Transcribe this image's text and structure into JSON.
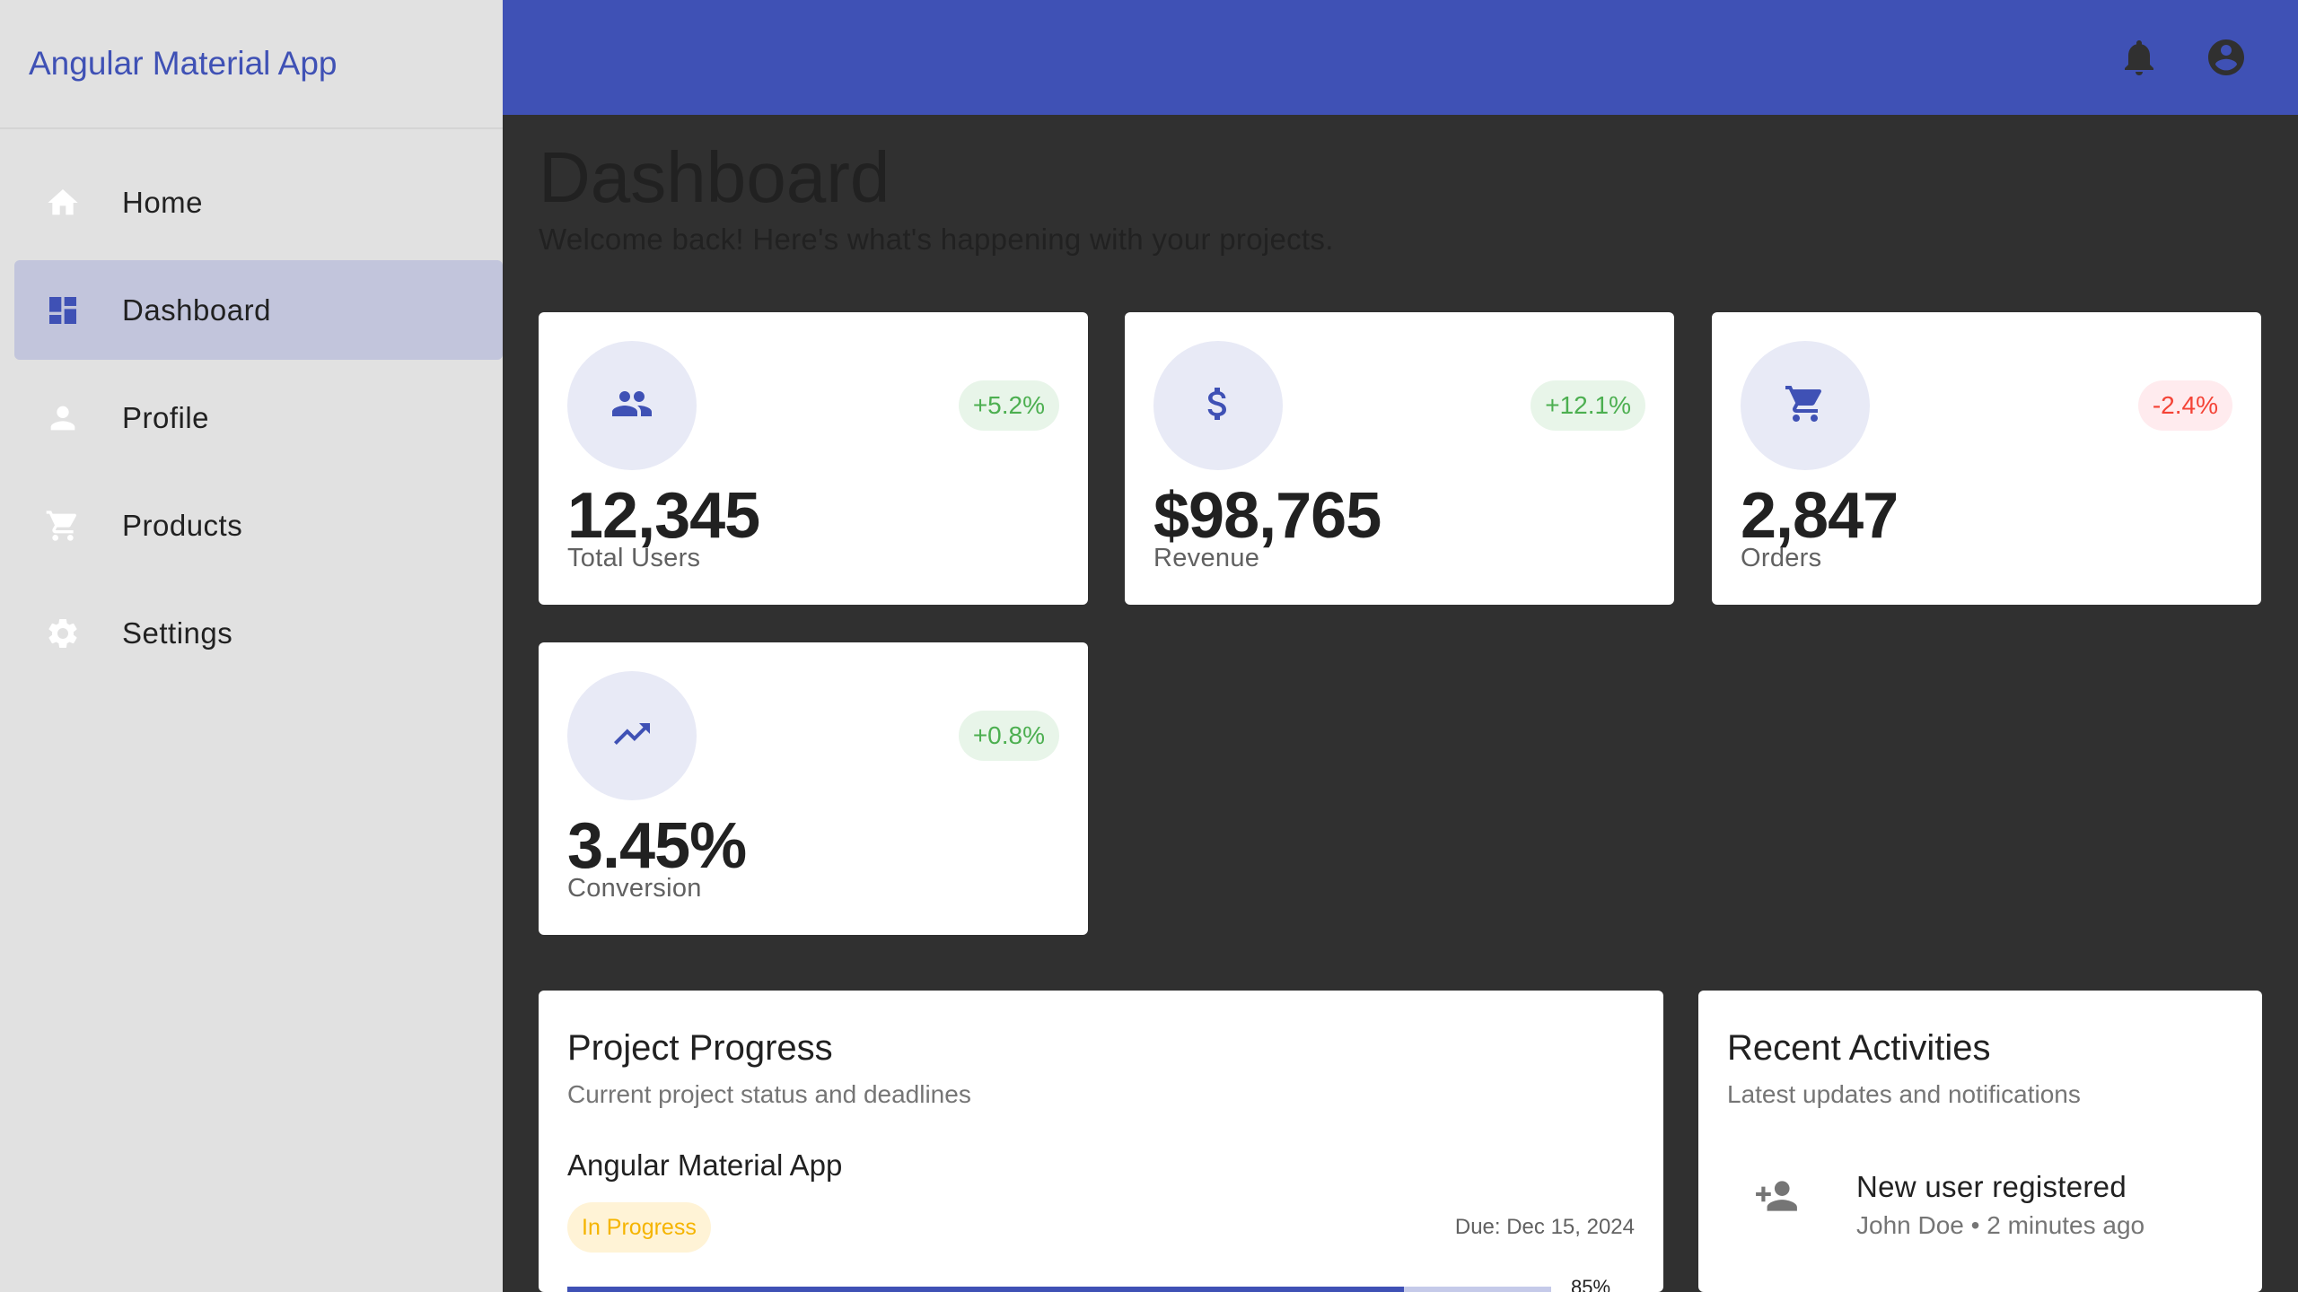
{
  "app": {
    "title": "Angular Material App"
  },
  "sidebar": {
    "items": [
      {
        "label": "Home",
        "icon": "home-icon",
        "active": false
      },
      {
        "label": "Dashboard",
        "icon": "dashboard-icon",
        "active": true
      },
      {
        "label": "Profile",
        "icon": "person-icon",
        "active": false
      },
      {
        "label": "Products",
        "icon": "cart-icon",
        "active": false
      },
      {
        "label": "Settings",
        "icon": "gear-icon",
        "active": false
      }
    ]
  },
  "topbar": {
    "icons": [
      "notifications-icon",
      "account-icon"
    ],
    "color": "#3f51b5"
  },
  "page": {
    "title": "Dashboard",
    "subtitle": "Welcome back! Here's what's happening with your projects."
  },
  "stats": [
    {
      "value": "12,345",
      "label": "Total Users",
      "change": "+5.2%",
      "trend": "positive",
      "icon": "people-icon"
    },
    {
      "value": "$98,765",
      "label": "Revenue",
      "change": "+12.1%",
      "trend": "positive",
      "icon": "dollar-icon"
    },
    {
      "value": "2,847",
      "label": "Orders",
      "change": "-2.4%",
      "trend": "negative",
      "icon": "cart-icon"
    },
    {
      "value": "3.45%",
      "label": "Conversion",
      "change": "+0.8%",
      "trend": "positive",
      "icon": "trending-up-icon"
    }
  ],
  "project_progress": {
    "title": "Project Progress",
    "subtitle": "Current project status and deadlines",
    "projects": [
      {
        "name": "Angular Material App",
        "status": "In Progress",
        "due": "Due: Dec 15, 2024",
        "progress": 0.85,
        "progress_label": "85%"
      }
    ]
  },
  "recent_activities": {
    "title": "Recent Activities",
    "subtitle": "Latest updates and notifications",
    "items": [
      {
        "title": "New user registered",
        "meta": "John Doe • 2 minutes ago",
        "icon": "person-add-icon"
      }
    ]
  },
  "colors": {
    "primary": "#3f51b5",
    "positive": "#4caf50",
    "negative": "#f44336",
    "warning": "#f5b400",
    "background": "#303030",
    "sidebar": "#e1e1e1"
  }
}
